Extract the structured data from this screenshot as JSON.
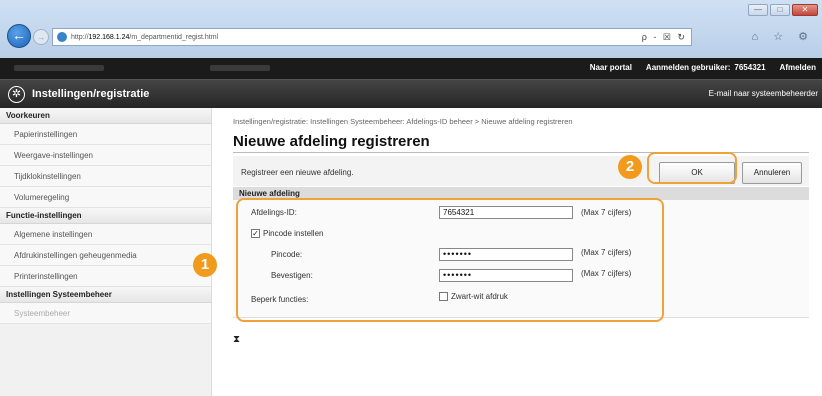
{
  "browser": {
    "url_prefix": "http://",
    "url_host": "192.168.1.24",
    "url_path": "/m_departmentid_regist.html",
    "address_actions": "ρ - ☒ ↻",
    "window_controls": [
      "—",
      "□",
      "✕"
    ],
    "toolbar_icons": "⌂ ☆ ⚙"
  },
  "header": {
    "links": [
      "Naar portal",
      "Aanmelden gebruiker:",
      "7654321",
      "Afmelden"
    ],
    "app_title": "Instellingen/registratie",
    "mail_link": "E-mail naar systeembeheerder"
  },
  "sidebar": {
    "sections": [
      {
        "heading": "Voorkeuren",
        "items": [
          "Papierinstellingen",
          "Weergave-instellingen",
          "Tijdklokinstellingen",
          "Volumeregeling"
        ]
      },
      {
        "heading": "Functie-instellingen",
        "items": [
          "Algemene instellingen",
          "Afdrukinstellingen geheugenmedia",
          "Printerinstellingen"
        ]
      },
      {
        "heading": "Instellingen Systeembeheer",
        "items": [
          "Systeembeheer"
        ]
      }
    ]
  },
  "main": {
    "breadcrumb": "Instellingen/registratie: Instellingen Systeembeheer: Afdelings-ID beheer > Nieuwe afdeling registreren",
    "title": "Nieuwe afdeling registreren",
    "intro": "Registreer een nieuwe afdeling.",
    "ok_label": "OK",
    "cancel_label": "Annuleren",
    "section_title": "Nieuwe afdeling",
    "fields": {
      "dept_id_label": "Afdelings-ID:",
      "dept_id_value": "7654321",
      "dept_id_hint": "(Max 7 cijfers)",
      "pin_checkbox_label": "Pincode instellen",
      "pin_checked": "✓",
      "pin_label": "Pincode:",
      "pin_value": "•••••••",
      "pin_hint": "(Max 7 cijfers)",
      "confirm_label": "Bevestigen:",
      "confirm_value": "•••••••",
      "confirm_hint": "(Max 7 cijfers)",
      "restrict_label": "Beperk functies:",
      "bw_print_label": "Zwart-wit afdruk"
    },
    "page_end_icon": "⧗"
  },
  "annotations": {
    "marker_1": "1",
    "marker_2": "2",
    "color": "#f19a1c"
  }
}
